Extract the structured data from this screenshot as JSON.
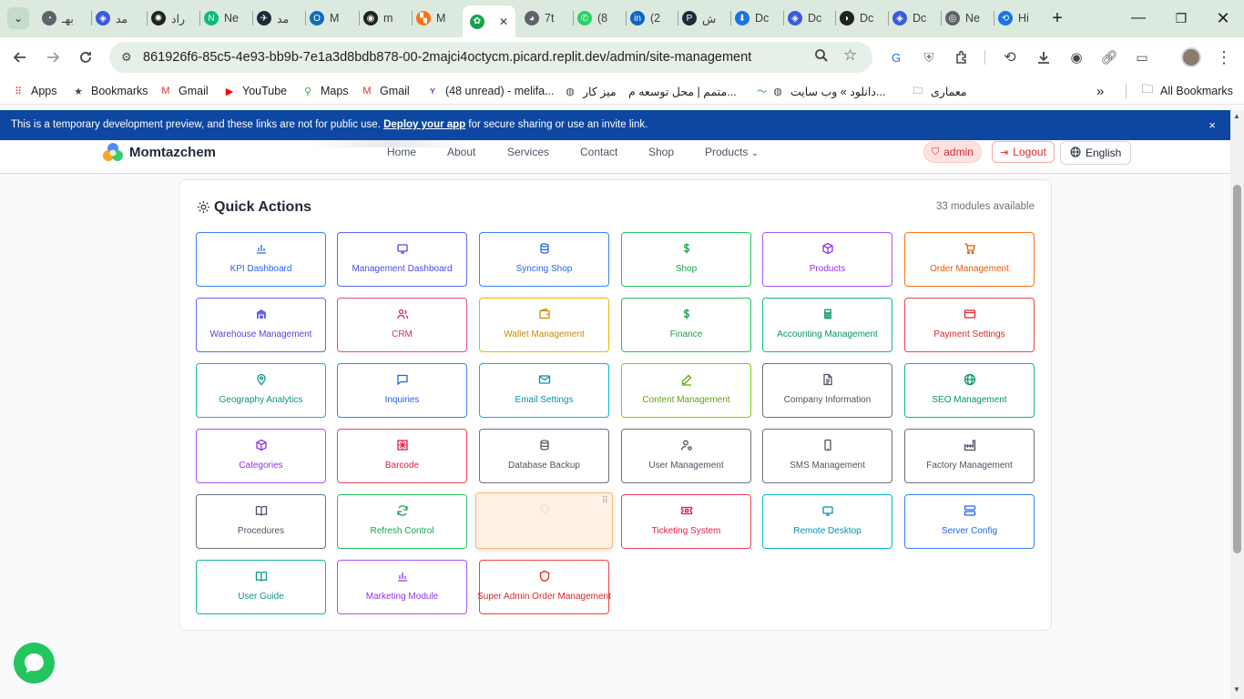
{
  "browser": {
    "tabs": [
      {
        "label": "بهـ",
        "icon": "ext-tab-icon",
        "color": "#5f6368"
      },
      {
        "label": "مد",
        "icon": "vscode-tab-icon",
        "color": "#3b5bdb"
      },
      {
        "label": "راد",
        "icon": "openai-tab-icon",
        "color": "#202124"
      },
      {
        "label": "Ne",
        "icon": "n-tab-icon",
        "color": "#10b981"
      },
      {
        "label": "مد",
        "icon": "swirl-tab-icon",
        "color": "#1f2937"
      },
      {
        "label": "M",
        "icon": "outlook-tab-icon",
        "color": "#0f6cbd"
      },
      {
        "label": "m",
        "icon": "github-tab-icon",
        "color": "#202124"
      },
      {
        "label": "M",
        "icon": "figma-tab-icon",
        "color": "#f97316"
      },
      {
        "label": "",
        "icon": "momtazchem-tab-icon",
        "color": "#16a34a"
      },
      {
        "label": "7t",
        "icon": "web-tab-icon",
        "color": "#5f6368"
      },
      {
        "label": "(8",
        "icon": "whatsapp-tab-icon",
        "color": "#25d366"
      },
      {
        "label": "(2",
        "icon": "linkedin-tab-icon",
        "color": "#0a66c2"
      },
      {
        "label": "ﺵ",
        "icon": "p-tab-icon",
        "color": "#1f2937"
      },
      {
        "label": "Dc",
        "icon": "download-tab-icon",
        "color": "#1a73e8"
      },
      {
        "label": "Dc",
        "icon": "vscode-tab-icon-2",
        "color": "#3b5bdb"
      },
      {
        "label": "Dc",
        "icon": "deepseek-tab-icon",
        "color": "#202124"
      },
      {
        "label": "Dc",
        "icon": "vscode-tab-icon-3",
        "color": "#3b5bdb"
      },
      {
        "label": "Ne",
        "icon": "chrome-tab-icon",
        "color": "#5f6368"
      },
      {
        "label": "Hi",
        "icon": "history-tab-icon",
        "color": "#1a73e8"
      }
    ],
    "new_tab": "+",
    "url": "861926f6-85c5-4e93-bb9b-7e1a3d8bdb878-00-2majci4octycm.picard.replit.dev/admin/site-management",
    "bookmarks": [
      {
        "label": "Apps",
        "icon": "apps-grid-icon"
      },
      {
        "label": "Bookmarks",
        "icon": "star-icon"
      },
      {
        "label": "Gmail",
        "icon": "gmail-icon"
      },
      {
        "label": "YouTube",
        "icon": "youtube-icon"
      },
      {
        "label": "Maps",
        "icon": "maps-icon"
      },
      {
        "label": "Gmail",
        "icon": "gmail-icon"
      },
      {
        "label": "(48 unread) - melifa...",
        "icon": "yahoo-icon"
      },
      {
        "label": "میز کار",
        "icon": "globe-icon"
      },
      {
        "label": "متمم | محل توسعه م...",
        "icon": "motamem-icon"
      },
      {
        "label": "دانلود » وب سایت...",
        "icon": "globe-icon"
      },
      {
        "label": "معماری",
        "icon": "folder-icon"
      }
    ],
    "all_bookmarks": "All Bookmarks",
    "more": "»"
  },
  "banner": {
    "text_before": "This is a temporary development preview, and these links are not for public use.",
    "link": "Deploy your app",
    "text_after": "for secure sharing or use an invite link.",
    "close": "×"
  },
  "site": {
    "brand": "Momtazchem",
    "nav": [
      "Home",
      "About",
      "Services",
      "Contact",
      "Shop",
      "Products"
    ],
    "products_chevron": "⌄",
    "admin": "admin",
    "logout": "Logout",
    "language": "English"
  },
  "panel": {
    "title": "Quick Actions",
    "count": "33 modules available",
    "modules": [
      {
        "label": "KPI Dashboard",
        "color": "#2563eb",
        "border": "#3b82f6",
        "icon": "bar-chart-icon"
      },
      {
        "label": "Management Dashboard",
        "color": "#4f46e5",
        "border": "#6366f1",
        "icon": "monitor-icon"
      },
      {
        "label": "Syncing Shop",
        "color": "#2563eb",
        "border": "#3b82f6",
        "icon": "database-icon"
      },
      {
        "label": "Shop",
        "color": "#16a34a",
        "border": "#22c55e",
        "icon": "dollar-icon"
      },
      {
        "label": "Products",
        "color": "#9333ea",
        "border": "#a855f7",
        "icon": "box-icon"
      },
      {
        "label": "Order Management",
        "color": "#ea580c",
        "border": "#f97316",
        "icon": "cart-icon"
      },
      {
        "label": "Warehouse Management",
        "color": "#4f46e5",
        "border": "#6366f1",
        "icon": "warehouse-icon"
      },
      {
        "label": "CRM",
        "color": "#db2777",
        "border": "#ec4899",
        "icon": "users-icon"
      },
      {
        "label": "Wallet Management",
        "color": "#ca8a04",
        "border": "#eab308",
        "icon": "wallet-icon"
      },
      {
        "label": "Finance",
        "color": "#16a34a",
        "border": "#22c55e",
        "icon": "dollar-icon"
      },
      {
        "label": "Accounting Management",
        "color": "#059669",
        "border": "#10b981",
        "icon": "calculator-icon"
      },
      {
        "label": "Payment Settings",
        "color": "#dc2626",
        "border": "#ef4444",
        "icon": "credit-card-icon"
      },
      {
        "label": "Geography Analytics",
        "color": "#0d9488",
        "border": "#14b8a6",
        "icon": "map-pin-icon"
      },
      {
        "label": "Inquiries",
        "color": "#2563eb",
        "border": "#3b82f6",
        "icon": "message-icon"
      },
      {
        "label": "Email Settings",
        "color": "#0891b2",
        "border": "#06b6d4",
        "icon": "mail-icon"
      },
      {
        "label": "Content Management",
        "color": "#65a30d",
        "border": "#84cc16",
        "icon": "edit-icon"
      },
      {
        "label": "Company Information",
        "color": "#4b5563",
        "border": "#6b7280",
        "icon": "document-icon"
      },
      {
        "label": "SEO Management",
        "color": "#059669",
        "border": "#10b981",
        "icon": "globe-icon"
      },
      {
        "label": "Categories",
        "color": "#9333ea",
        "border": "#a855f7",
        "icon": "box-icon"
      },
      {
        "label": "Barcode",
        "color": "#e11d48",
        "border": "#f43f5e",
        "icon": "barcode-icon"
      },
      {
        "label": "Database Backup",
        "color": "#4b5563",
        "border": "#6b7280",
        "icon": "database-icon"
      },
      {
        "label": "User Management",
        "color": "#4b5563",
        "border": "#6b7280",
        "icon": "user-cog-icon"
      },
      {
        "label": "SMS Management",
        "color": "#4b5563",
        "border": "#6b7280",
        "icon": "smartphone-icon"
      },
      {
        "label": "Factory Management",
        "color": "#4b5563",
        "border": "#6b7280",
        "icon": "factory-icon"
      },
      {
        "label": "Procedures",
        "color": "#4b5563",
        "border": "#6b7280",
        "icon": "book-icon"
      },
      {
        "label": "Refresh Control",
        "color": "#16a34a",
        "border": "#22c55e",
        "icon": "refresh-icon"
      },
      {
        "label": "",
        "color": "#ea580c",
        "border": "#fdba74",
        "icon": "dragged-module-icon",
        "dragging": true
      },
      {
        "label": "Ticketing System",
        "color": "#e11d48",
        "border": "#f43f5e",
        "icon": "ticket-icon"
      },
      {
        "label": "Remote Desktop",
        "color": "#0891b2",
        "border": "#06b6d4",
        "icon": "monitor-icon"
      },
      {
        "label": "Server Config",
        "color": "#2563eb",
        "border": "#3b82f6",
        "icon": "server-icon"
      },
      {
        "label": "User Guide",
        "color": "#0d9488",
        "border": "#14b8a6",
        "icon": "book-open-icon"
      },
      {
        "label": "Marketing Module",
        "color": "#9333ea",
        "border": "#a855f7",
        "icon": "bar-chart-icon"
      },
      {
        "label": "Super Admin Order Management",
        "color": "#dc2626",
        "border": "#ef4444",
        "icon": "shield-icon"
      }
    ]
  }
}
